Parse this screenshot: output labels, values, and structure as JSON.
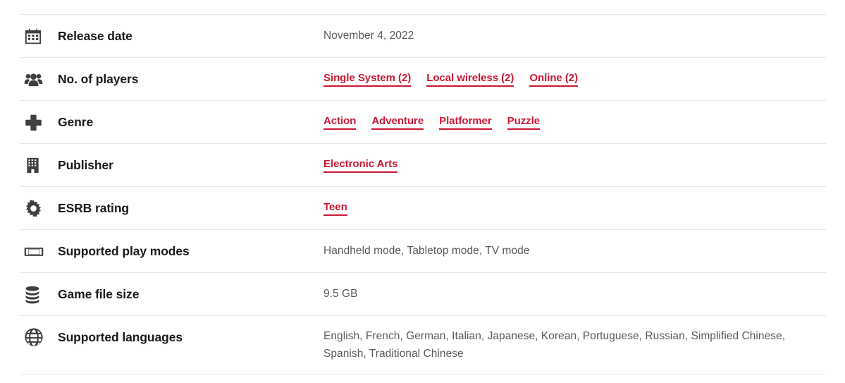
{
  "colors": {
    "link": "#cc1733",
    "label": "#1a1a1a",
    "value": "#58595b",
    "divider": "#e6e6e6",
    "icon": "#3f3f3f"
  },
  "rows": [
    {
      "icon": "calendar-icon",
      "label": "Release date",
      "type": "text",
      "value": "November 4, 2022"
    },
    {
      "icon": "players-icon",
      "label": "No. of players",
      "type": "links",
      "links": [
        "Single System (2)",
        "Local wireless (2)",
        "Online (2)"
      ]
    },
    {
      "icon": "dpad-icon",
      "label": "Genre",
      "type": "links",
      "links": [
        "Action",
        "Adventure",
        "Platformer",
        "Puzzle"
      ]
    },
    {
      "icon": "building-icon",
      "label": "Publisher",
      "type": "links",
      "links": [
        "Electronic Arts"
      ]
    },
    {
      "icon": "gear-icon",
      "label": "ESRB rating",
      "type": "links",
      "links": [
        "Teen"
      ]
    },
    {
      "icon": "handheld-icon",
      "label": "Supported play modes",
      "type": "text",
      "value": "Handheld mode, Tabletop mode, TV mode"
    },
    {
      "icon": "database-icon",
      "label": "Game file size",
      "type": "text",
      "value": "9.5 GB"
    },
    {
      "icon": "globe-icon",
      "label": "Supported languages",
      "type": "text",
      "value": "English, French, German, Italian, Japanese, Korean, Portuguese, Russian, Simplified Chinese, Spanish, Traditional Chinese"
    }
  ]
}
